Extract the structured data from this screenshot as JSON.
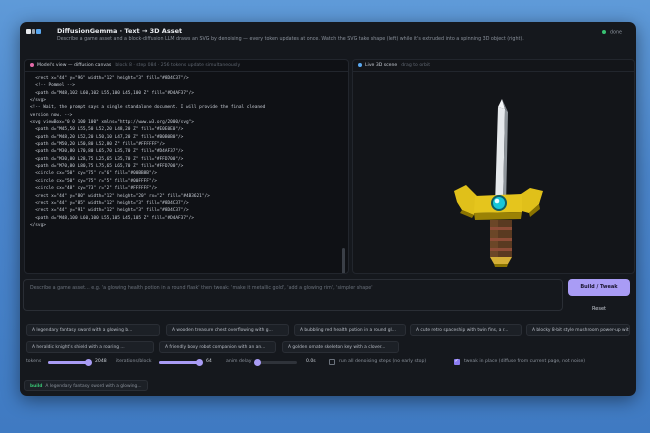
{
  "header": {
    "title": "DiffusionGemma · Text → 3D Asset",
    "subtitle": "Describe a game asset and a block-diffusion LLM draws an SVG by denoising — every token updates at once. Watch the SVG take shape (left) while it's extruded into a spinning 3D object (right).",
    "status": "done",
    "status_color": "#38c172"
  },
  "left_panel": {
    "title": "Model's view — diffusion canvas",
    "meta": "block 8 · step 084 · 256 tokens update simultaneously",
    "dot_color": "#e46aa8",
    "code_lines": [
      "  <rect x=\"44\" y=\"96\" width=\"12\" height=\"3\" fill=\"#8D4C37\"/>",
      "  <!-- Pommel -->",
      "  <path d=\"M48,102 L60,102 L55,100 L45,100 Z\" fill=\"#D4AF37\"/>",
      "</svg>",
      "<!-- Wait, the prompt says a single standalone document. I will provide the final cleaned",
      "version now. -->",
      "<svg viewBox=\"0 0 100 100\" xmlns=\"http://www.w3.org/2000/svg\">",
      "  <path d=\"M45,50 L55,50 L52,20 L48,20 Z\" fill=\"#E0E0E0\"/>",
      "  <path d=\"M48,20 L52,20 L50,10 L47,20 Z\" fill=\"#B0B0B0\"/>",
      "  <path d=\"M50,20 L50,80 L52,80 Z\" fill=\"#FFFFFF\"/>",
      "  <path d=\"M30,80 L70,80 L65,70 L35,70 Z\" fill=\"#D4AF37\"/>",
      "  <path d=\"M30,80 L28,75 L25,65 L35,70 Z\" fill=\"#FFD700\"/>",
      "  <path d=\"M70,80 L80,75 L75,65 L65,70 Z\" fill=\"#FFD700\"/>",
      "  <circle cx=\"50\" cy=\"75\" r=\"6\" fill=\"#00BB8B\"/>",
      "  <circle cx=\"50\" cy=\"75\" r=\"5\" fill=\"#00FFFF\"/>",
      "  <circle cx=\"48\" cy=\"73\" r=\"2\" fill=\"#FFFFFF\"/>",
      "  <rect x=\"44\" y=\"80\" width=\"12\" height=\"20\" rx=\"2\" fill=\"#4B3621\"/>",
      "  <rect x=\"44\" y=\"85\" width=\"12\" height=\"3\" fill=\"#8D4C37\"/>",
      "  <rect x=\"44\" y=\"91\" width=\"12\" height=\"3\" fill=\"#8D4C37\"/>",
      "  <path d=\"M48,100 L60,100 L55,105 L45,105 Z\" fill=\"#D4AF37\"/>",
      "</svg>"
    ]
  },
  "right_panel": {
    "title": "Live 3D scene",
    "hint": "drag to orbit",
    "dot_color": "#5aa8f0"
  },
  "prompt": {
    "placeholder": "Describe a game asset…  e.g. 'a glowing health potion in a round flask'   then tweak: 'make it metallic gold', 'add a glowing rim', 'simpler shape'",
    "build_label": "Build / Tweak",
    "reset_label": "Reset"
  },
  "examples": [
    "A legendary fantasy sword with a glowing b...",
    "A wooden treasure chest overflowing with g...",
    "A bubbling red health potion in a round gl...",
    "A cute retro spaceship with twin fins, a r...",
    "A blocky 8-bit style mushroom power-up wit...",
    "A heraldic knight's shield with a roaring ...",
    "A friendly boxy robot companion with an an...",
    "A golden ornate skeleton key with a clover..."
  ],
  "controls": {
    "tokens_label": "tokens",
    "tokens_value": "2048",
    "tokens_fraction": 1.0,
    "iterations_label": "iterations/block",
    "iterations_value": "64",
    "iterations_fraction": 1.0,
    "anim_label": "anim delay",
    "anim_value": "0.0s",
    "anim_fraction": 0.0,
    "run_all_label": "run all denoising steps (no early stop)",
    "run_all_checked": false,
    "tweak_label": "tweak in place (diffuse from current page, not noise)",
    "tweak_checked": true
  },
  "log": {
    "tag": "build",
    "text": "A legendary fantasy sword with a glowing..."
  }
}
